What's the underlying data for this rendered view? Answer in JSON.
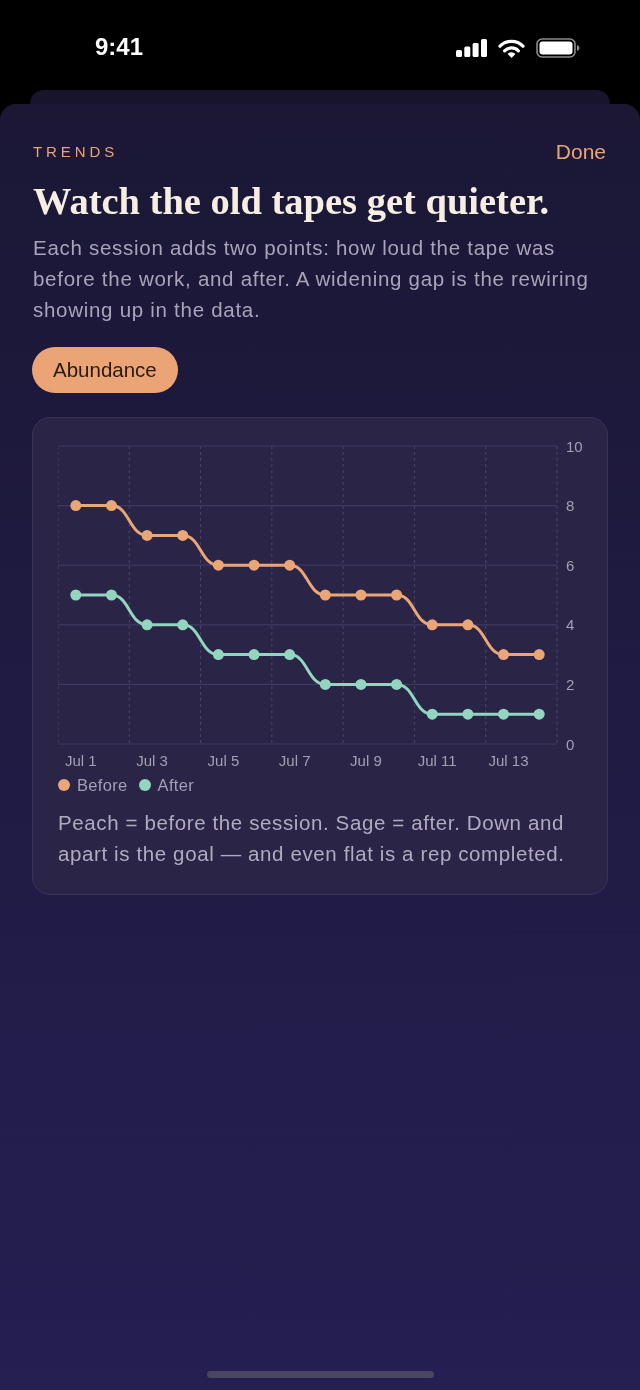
{
  "status_bar": {
    "time": "9:41"
  },
  "header": {
    "eyebrow": "TRENDS",
    "done_button": "Done"
  },
  "title": "Watch the old tapes get quieter.",
  "description": "Each session adds two points: how loud the tape was before the work, and after. A widening gap is the rewiring showing up in the data.",
  "chips": [
    {
      "label": "Abundance",
      "selected": true
    }
  ],
  "chart_card": {
    "chart_data": {
      "type": "line",
      "categories": [
        "Jul 1",
        null,
        "Jul 3",
        null,
        "Jul 5",
        null,
        "Jul 7",
        null,
        "Jul 9",
        null,
        "Jul 11",
        null,
        "Jul 13",
        null
      ],
      "series": [
        {
          "name": "Before",
          "color": "#eba677",
          "marker": "circle",
          "values": [
            8,
            8,
            7,
            7,
            6,
            6,
            6,
            5,
            5,
            5,
            4,
            4,
            3,
            3
          ]
        },
        {
          "name": "After",
          "color": "#93d6c0",
          "marker": "circle",
          "values": [
            5,
            5,
            4,
            4,
            3,
            3,
            3,
            2,
            2,
            2,
            1,
            1,
            1,
            1
          ]
        }
      ],
      "ylim": [
        0,
        10
      ],
      "yticks": [
        0,
        2,
        4,
        6,
        8,
        10
      ],
      "grid": true
    },
    "caption": "Peach = before the session. Sage = after. Down and apart is the goal — and even flat is a rep completed."
  }
}
